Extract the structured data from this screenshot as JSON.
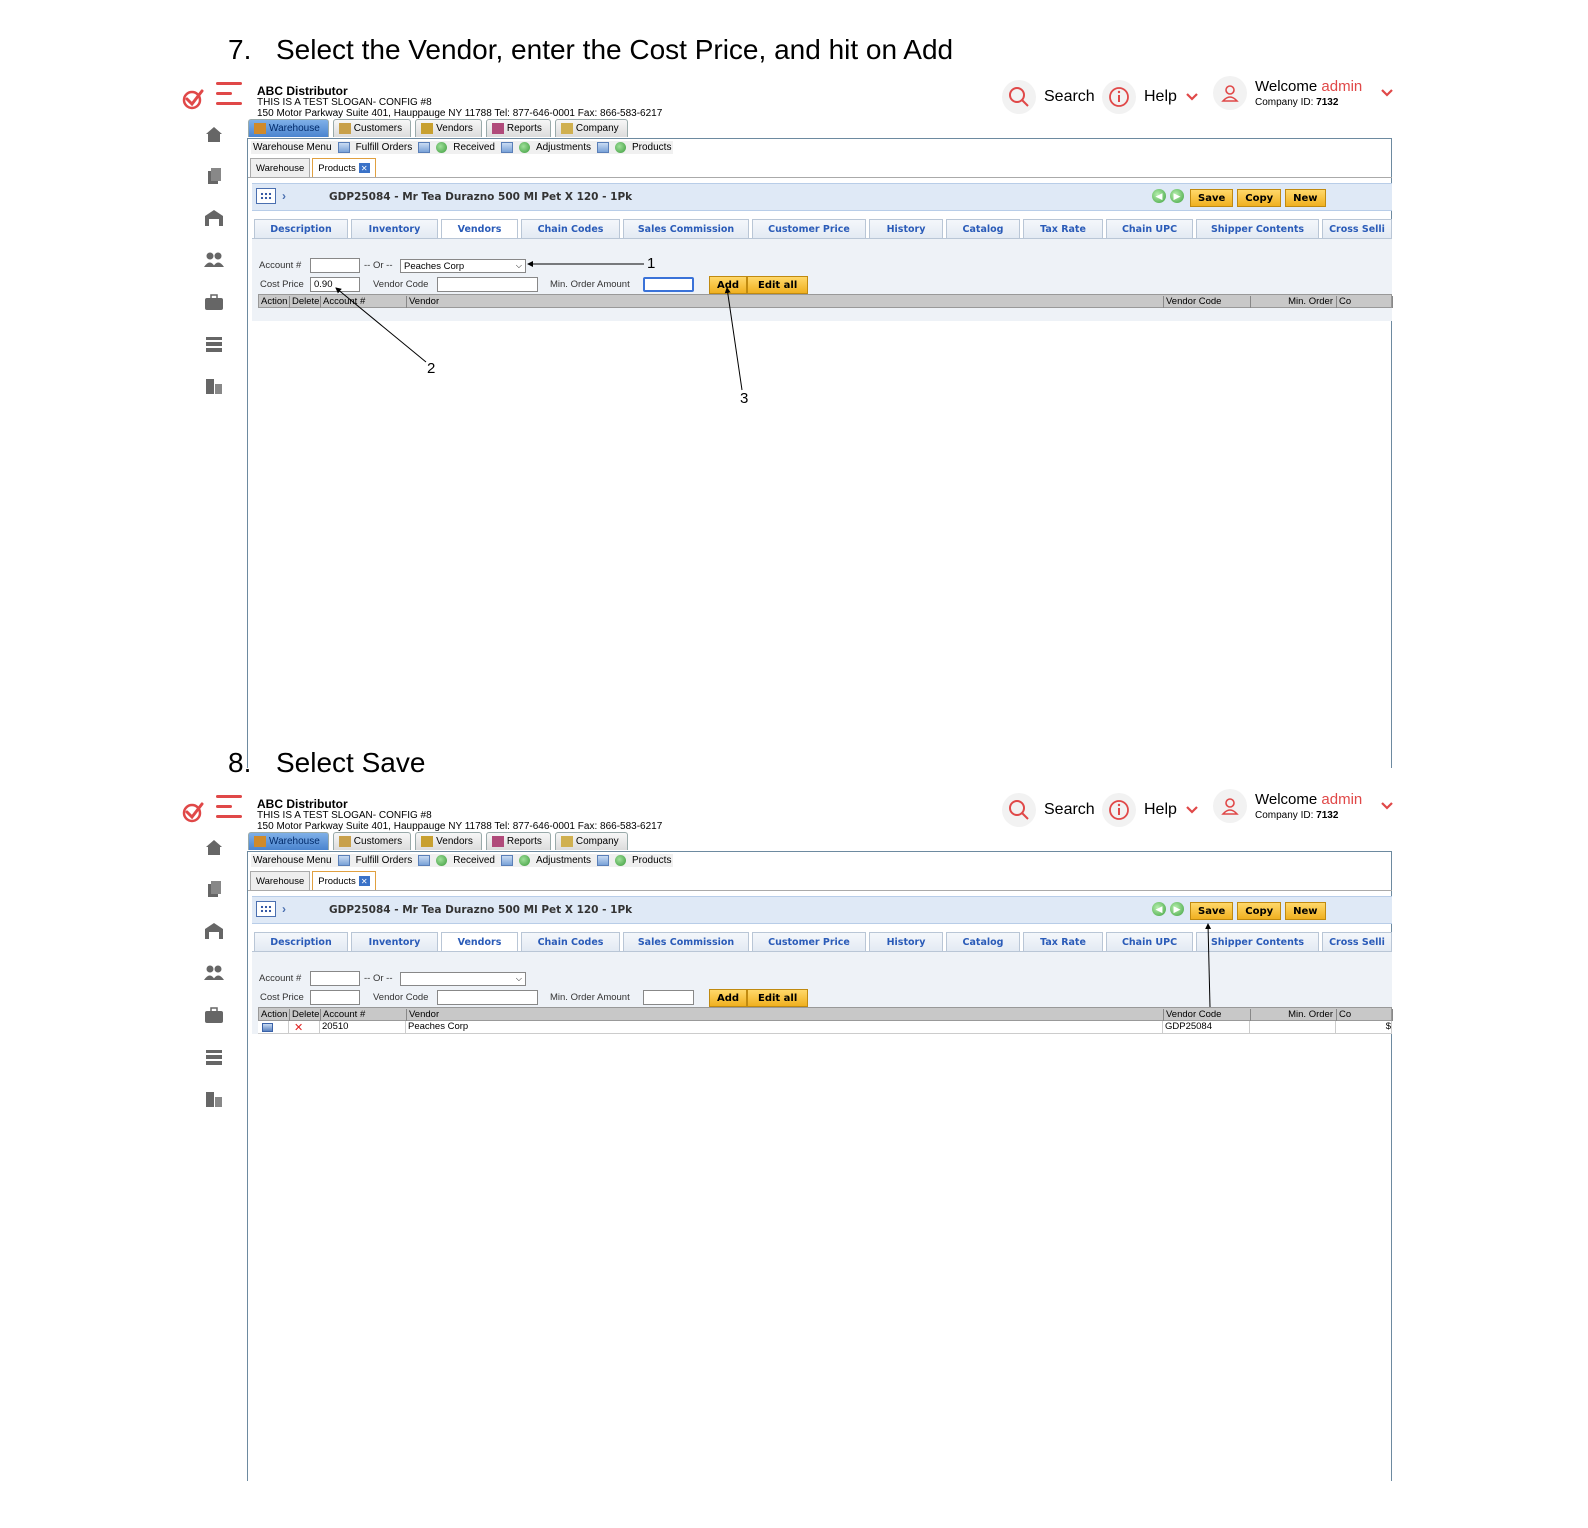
{
  "steps": [
    {
      "number": "7.",
      "title": "Select the Vendor, enter the Cost Price, and hit on Add",
      "form": {
        "account_value": "",
        "vendor_selected": "Peaches Corp",
        "cost_price_value": "0.90",
        "vendor_code_value": "",
        "min_order_value": ""
      },
      "rows": [],
      "annotations": [
        "1",
        "2",
        "3"
      ]
    },
    {
      "number": "8.",
      "title": "Select Save",
      "form": {
        "account_value": "",
        "vendor_selected": "",
        "cost_price_value": "",
        "vendor_code_value": "",
        "min_order_value": ""
      },
      "rows": [
        {
          "account": "20510",
          "vendor": "Peaches Corp",
          "vendor_code": "GDP25084",
          "min_order": "",
          "cost": "$"
        }
      ],
      "annotations": []
    }
  ],
  "app": {
    "company_name": "ABC Distributor",
    "slogan": "THIS IS A TEST SLOGAN- CONFIG #8",
    "address": "150 Motor Parkway Suite 401, Hauppauge NY 11788 Tel: 877-646-0001 Fax: 866-583-6217",
    "search_label": "Search",
    "help_label": "Help",
    "welcome_label": "Welcome",
    "username": "admin",
    "company_id_label": "Company ID:",
    "company_id": "7132",
    "main_tabs": [
      "Warehouse",
      "Customers",
      "Vendors",
      "Reports",
      "Company"
    ],
    "submenu": [
      "Warehouse Menu",
      "Fulfill Orders",
      "Received",
      "Adjustments",
      "Products"
    ],
    "subtabs": [
      "Warehouse",
      "Products"
    ],
    "product_title": "GDP25084 - Mr Tea Durazno 500 Ml Pet X 120 - 1Pk",
    "buttons": {
      "save": "Save",
      "copy": "Copy",
      "new": "New",
      "add": "Add",
      "edit_all": "Edit all"
    },
    "detail_tabs": [
      "Description",
      "Inventory",
      "Vendors",
      "Chain Codes",
      "Sales Commission",
      "Customer Price",
      "History",
      "Catalog",
      "Tax Rate",
      "Chain UPC",
      "Shipper Contents",
      "Cross Selli"
    ],
    "form_labels": {
      "account": "Account #",
      "or": "-- Or --",
      "cost_price": "Cost Price",
      "vendor_code": "Vendor Code",
      "min_order": "Min. Order Amount"
    },
    "table_headers": [
      "Action",
      "Delete",
      "Account #",
      "Vendor",
      "Vendor Code",
      "Min. Order",
      "Co"
    ]
  },
  "colors": {
    "brand_red": "#e04848",
    "link_blue": "#2a5bb8",
    "button_yellow": "#f0b020"
  }
}
